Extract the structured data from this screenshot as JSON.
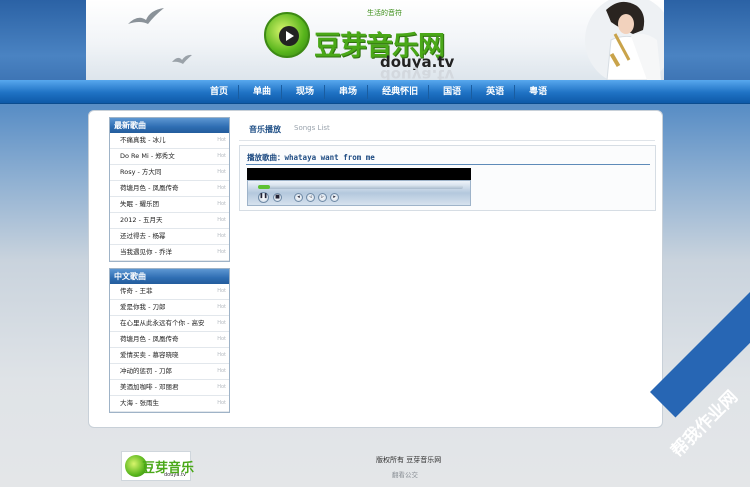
{
  "header": {
    "logo_slogan": "生活的音符",
    "logo_cn": "豆芽音乐网",
    "logo_en": "douya.tv"
  },
  "nav": {
    "items": [
      "首页",
      "单曲",
      "现场",
      "串场",
      "经典怀旧",
      "国语",
      "英语",
      "粤语"
    ]
  },
  "sidebar": {
    "latest": {
      "title": "最新歌曲",
      "items": [
        "不痛真我 - 冰儿",
        "Do Re Mi - 郑秀文",
        "Rosy - 方大同",
        "荷塘月色 - 凤凰传奇",
        "失眠 - 耀乐团",
        "2012 - 五月天",
        "还过得去 - 杨幂",
        "当我遇见你 - 乔洋"
      ]
    },
    "chinese": {
      "title": "中文歌曲",
      "items": [
        "传奇 - 王菲",
        "爱是你我 - 刀郎",
        "在心里从此永远有个你 - 高安",
        "荷塘月色 - 凤凰传奇",
        "爱情买卖 - 慕容晓晓",
        "冲动的惩罚 - 刀郎",
        "美酒加咖啡 - 邓丽君",
        "大海 - 张雨生"
      ]
    },
    "row_tag": "Hot"
  },
  "main": {
    "tab_active": "音乐播放",
    "tab_inactive": "Songs List",
    "playing_title": "播放歌曲：whataya want from me"
  },
  "player": {
    "progress": 0.06,
    "ctl_pause": "❚❚",
    "ctl_stop": "■",
    "ctl_prev": "◂",
    "ctl_rewind": "◃",
    "ctl_forward": "▹",
    "ctl_next": "▸"
  },
  "footer": {
    "logo_cn": "豆芽音乐",
    "logo_en": "douya.tv",
    "copyright": "版权所有 豆芽音乐网",
    "link": "翻看公交"
  },
  "watermark": "帮我作业网",
  "colors": {
    "brand_blue": "#1f72c4",
    "logo_green": "#4aa818",
    "watermark": "#2766b4"
  }
}
